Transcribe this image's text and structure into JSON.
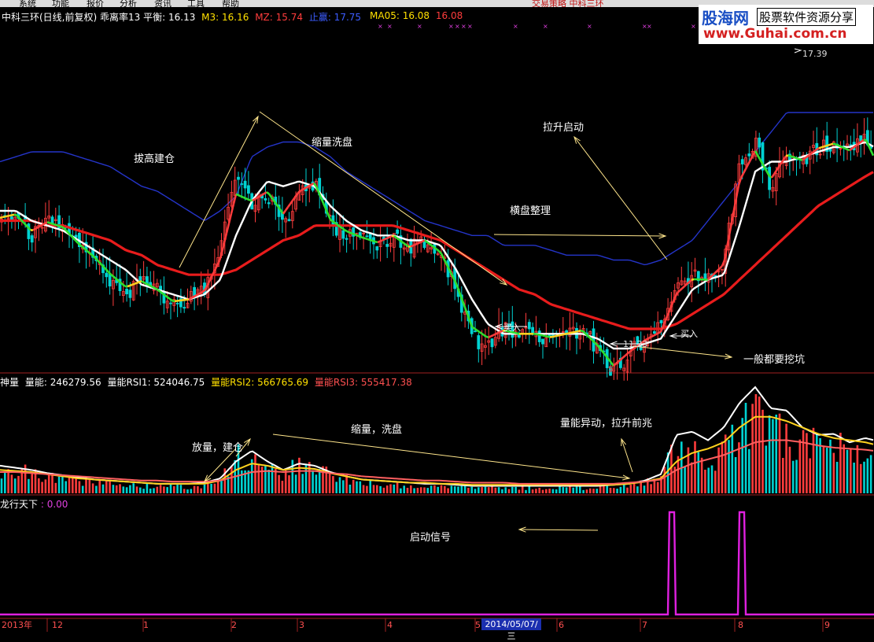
{
  "menu": [
    "系统",
    "功能",
    "报价",
    "分析",
    "资讯",
    "工具",
    "帮助"
  ],
  "top_banner": "交易策略  中科三环",
  "header": {
    "security": "中科三环(日线,前复权)",
    "indicator": "乖离率13",
    "balance_label": "平衡: 16.13",
    "m3_label": "M3: 16.16",
    "mz_label": "MZ: 15.74",
    "stop_label": "止赢: 17.75",
    "ma05_label": "MA05: 16.08",
    "ma05_val": "16.08"
  },
  "logo": {
    "line1": "股海网",
    "line2": "股票软件资源分享",
    "line3": "www.Guhai.com.cn"
  },
  "volume_header": {
    "name": "神量",
    "v1": "量能: 246279.56",
    "v2": "量能RSI1: 524046.75",
    "v3": "量能RSI2: 566765.69",
    "v4": "量能RSI3: 555417.38"
  },
  "signal_header": {
    "name": "龙行天下",
    "value": ": 0.00"
  },
  "xaxis": {
    "labels": [
      "2013年",
      "12",
      "1",
      "2",
      "3",
      "4",
      "5",
      "6",
      "7",
      "8",
      "9"
    ],
    "cursor_date": "2014/05/07/三"
  },
  "annotations": {
    "a1": "拔高建仓",
    "a2": "缩量洗盘",
    "a3": "拉升启动",
    "a4": "横盘整理",
    "a5": "买入",
    "a6": "买入",
    "a7": "一般都要挖坑",
    "a8": "17.39",
    "a9": "11.23",
    "b1": "放量，建仓",
    "b2": "缩量，洗盘",
    "b3": "量能异动，拉升前兆",
    "c1": "启动信号",
    "s1": "$"
  },
  "colors": {
    "up": "#ff3c3c",
    "down": "#00d2d2",
    "ma_white": "#ffffff",
    "ma_red": "#e81c1c",
    "band": "#2434c8",
    "line_green": "#2ee02e",
    "line_yellow": "#ffd21e",
    "signal": "#e020e0",
    "axis": "#a02020"
  },
  "chart_data": [
    {
      "type": "line",
      "title": "中科三环(日线,前复权) 乖离率13",
      "x": [
        0,
        20,
        40,
        60,
        80,
        100,
        120,
        140,
        160,
        180,
        200,
        220,
        240,
        260,
        280,
        300,
        320,
        340,
        360,
        380,
        400,
        420,
        440,
        460,
        480,
        500,
        520,
        540,
        560,
        580,
        600,
        620,
        640,
        660,
        680,
        700,
        720,
        740,
        760,
        780,
        800,
        820,
        840,
        860,
        880,
        900,
        920,
        940,
        960,
        980,
        1000,
        1020,
        1040,
        1060,
        1080,
        1100,
        1111
      ],
      "series": [
        {
          "name": "close",
          "values": [
            15.4,
            15.5,
            15.1,
            15.4,
            15.3,
            14.9,
            14.6,
            14.2,
            13.9,
            14.2,
            14.0,
            13.7,
            13.8,
            14.0,
            14.8,
            16.3,
            15.8,
            15.9,
            15.3,
            15.9,
            16.2,
            15.3,
            15.1,
            15.0,
            14.9,
            15.1,
            14.8,
            15.0,
            14.7,
            14.0,
            13.0,
            12.9,
            13.2,
            13.1,
            13.1,
            13.0,
            13.1,
            13.2,
            12.8,
            12.3,
            12.7,
            13.0,
            13.2,
            14.1,
            14.3,
            14.2,
            14.6,
            16.6,
            17.0,
            16.1,
            16.8,
            16.6,
            16.9,
            17.0,
            16.8,
            17.1,
            16.6
          ]
        },
        {
          "name": "white",
          "values": [
            15.6,
            15.6,
            15.4,
            15.3,
            15.2,
            15.0,
            14.8,
            14.6,
            14.4,
            14.1,
            14.0,
            13.9,
            13.8,
            13.9,
            14.2,
            15.1,
            15.8,
            16.2,
            16.1,
            16.2,
            16.1,
            15.7,
            15.4,
            15.2,
            15.1,
            15.1,
            15.0,
            15.0,
            14.9,
            14.4,
            13.8,
            13.3,
            13.1,
            13.1,
            13.1,
            13.1,
            13.1,
            13.1,
            13.0,
            12.8,
            12.8,
            12.9,
            13.0,
            13.5,
            14.0,
            14.2,
            14.3,
            15.3,
            16.4,
            16.6,
            16.6,
            16.7,
            16.8,
            16.9,
            16.9,
            17.0,
            16.9
          ]
        },
        {
          "name": "red",
          "values": [
            15.4,
            15.4,
            15.4,
            15.3,
            15.3,
            15.2,
            15.1,
            15.0,
            14.8,
            14.7,
            14.5,
            14.4,
            14.3,
            14.3,
            14.3,
            14.4,
            14.6,
            14.8,
            15.0,
            15.1,
            15.3,
            15.3,
            15.3,
            15.3,
            15.3,
            15.3,
            15.2,
            15.1,
            15.0,
            14.8,
            14.6,
            14.4,
            14.2,
            14.0,
            13.9,
            13.7,
            13.6,
            13.5,
            13.4,
            13.3,
            13.2,
            13.2,
            13.2,
            13.3,
            13.5,
            13.7,
            13.9,
            14.2,
            14.5,
            14.8,
            15.1,
            15.4,
            15.7,
            15.9,
            16.1,
            16.3,
            16.4
          ]
        },
        {
          "name": "band",
          "values": [
            16.6,
            16.7,
            16.8,
            16.8,
            16.8,
            16.7,
            16.6,
            16.5,
            16.3,
            16.1,
            16.0,
            15.8,
            15.6,
            15.4,
            15.6,
            15.9,
            16.7,
            16.9,
            17.0,
            17.0,
            16.9,
            16.7,
            16.4,
            16.2,
            16.0,
            15.8,
            15.6,
            15.4,
            15.3,
            15.2,
            15.1,
            15.1,
            14.9,
            14.9,
            14.9,
            14.8,
            14.7,
            14.7,
            14.7,
            14.6,
            14.6,
            14.5,
            14.6,
            14.8,
            15.0,
            15.4,
            15.8,
            16.2,
            16.8,
            17.2,
            17.6,
            17.6,
            17.6,
            17.6,
            17.6,
            17.6,
            17.6
          ]
        }
      ]
    },
    {
      "type": "bar",
      "title": "神量",
      "x": [
        0,
        20,
        40,
        60,
        80,
        100,
        120,
        140,
        160,
        180,
        200,
        220,
        240,
        260,
        280,
        300,
        320,
        340,
        360,
        380,
        400,
        420,
        440,
        460,
        480,
        500,
        520,
        540,
        560,
        580,
        600,
        620,
        640,
        660,
        680,
        700,
        720,
        740,
        760,
        780,
        800,
        820,
        840,
        860,
        880,
        900,
        920,
        940,
        960,
        980,
        1000,
        1020,
        1040,
        1060,
        1080,
        1100,
        1111
      ],
      "values": [
        0.2,
        0.22,
        0.18,
        0.15,
        0.14,
        0.12,
        0.1,
        0.09,
        0.08,
        0.07,
        0.07,
        0.06,
        0.06,
        0.07,
        0.12,
        0.34,
        0.3,
        0.22,
        0.18,
        0.28,
        0.24,
        0.16,
        0.13,
        0.11,
        0.09,
        0.08,
        0.07,
        0.07,
        0.06,
        0.06,
        0.05,
        0.05,
        0.05,
        0.05,
        0.05,
        0.05,
        0.05,
        0.05,
        0.06,
        0.06,
        0.07,
        0.1,
        0.14,
        0.45,
        0.38,
        0.3,
        0.4,
        0.62,
        0.74,
        0.6,
        0.52,
        0.48,
        0.54,
        0.44,
        0.38,
        0.42,
        0.4
      ],
      "series": [
        {
          "name": "量能RSI1",
          "values": [
            0.26,
            0.24,
            0.22,
            0.19,
            0.17,
            0.15,
            0.13,
            0.12,
            0.11,
            0.1,
            0.09,
            0.09,
            0.09,
            0.1,
            0.14,
            0.3,
            0.4,
            0.3,
            0.22,
            0.28,
            0.26,
            0.2,
            0.16,
            0.13,
            0.12,
            0.11,
            0.1,
            0.09,
            0.09,
            0.08,
            0.07,
            0.07,
            0.07,
            0.07,
            0.07,
            0.07,
            0.07,
            0.07,
            0.07,
            0.08,
            0.09,
            0.12,
            0.18,
            0.55,
            0.58,
            0.5,
            0.62,
            0.85,
            1.0,
            0.8,
            0.78,
            0.62,
            0.55,
            0.56,
            0.48,
            0.52,
            0.5
          ]
        },
        {
          "name": "量能RSI2",
          "values": [
            0.22,
            0.21,
            0.2,
            0.18,
            0.16,
            0.14,
            0.13,
            0.12,
            0.11,
            0.1,
            0.09,
            0.09,
            0.09,
            0.09,
            0.12,
            0.22,
            0.28,
            0.26,
            0.22,
            0.24,
            0.23,
            0.19,
            0.16,
            0.13,
            0.12,
            0.11,
            0.1,
            0.1,
            0.09,
            0.09,
            0.08,
            0.08,
            0.08,
            0.08,
            0.08,
            0.08,
            0.08,
            0.08,
            0.08,
            0.08,
            0.09,
            0.11,
            0.14,
            0.3,
            0.38,
            0.42,
            0.48,
            0.62,
            0.72,
            0.72,
            0.68,
            0.62,
            0.56,
            0.52,
            0.5,
            0.48,
            0.46
          ]
        },
        {
          "name": "量能RSI3",
          "values": [
            0.2,
            0.2,
            0.19,
            0.18,
            0.17,
            0.16,
            0.15,
            0.14,
            0.13,
            0.12,
            0.12,
            0.11,
            0.11,
            0.11,
            0.12,
            0.16,
            0.2,
            0.21,
            0.2,
            0.21,
            0.21,
            0.19,
            0.18,
            0.16,
            0.15,
            0.14,
            0.13,
            0.12,
            0.12,
            0.11,
            0.1,
            0.1,
            0.1,
            0.09,
            0.09,
            0.09,
            0.09,
            0.09,
            0.09,
            0.09,
            0.1,
            0.11,
            0.13,
            0.22,
            0.28,
            0.32,
            0.36,
            0.42,
            0.48,
            0.5,
            0.5,
            0.48,
            0.45,
            0.43,
            0.42,
            0.41,
            0.4
          ]
        }
      ]
    },
    {
      "type": "line",
      "title": "龙行天下",
      "x": [
        0,
        849,
        851,
        853,
        855,
        857,
        859,
        938,
        940,
        942,
        944,
        946,
        948,
        1111
      ],
      "values": [
        0,
        0,
        1,
        1,
        1,
        1,
        0,
        0,
        1,
        1,
        1,
        1,
        0,
        0
      ]
    }
  ]
}
